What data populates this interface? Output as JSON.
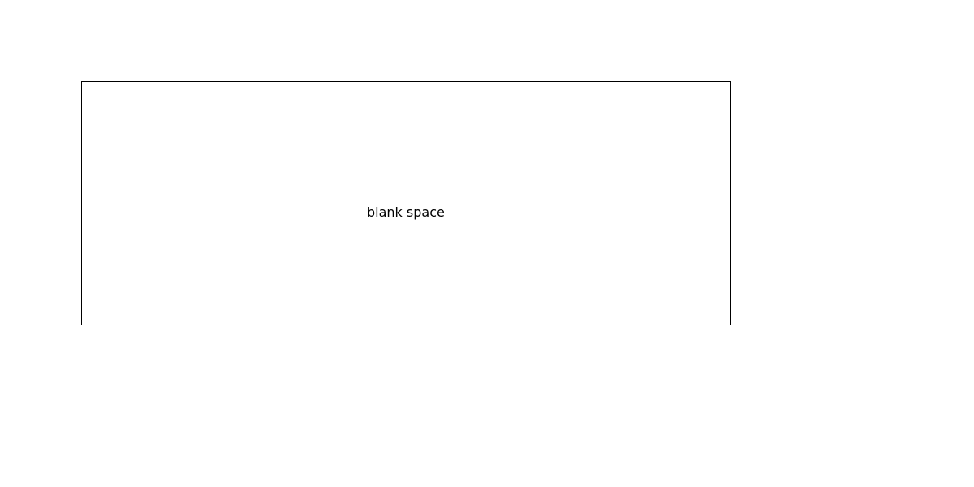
{
  "placeholder": {
    "text": "blank space",
    "border_color": "#000000",
    "background_color": "#ffffff"
  }
}
